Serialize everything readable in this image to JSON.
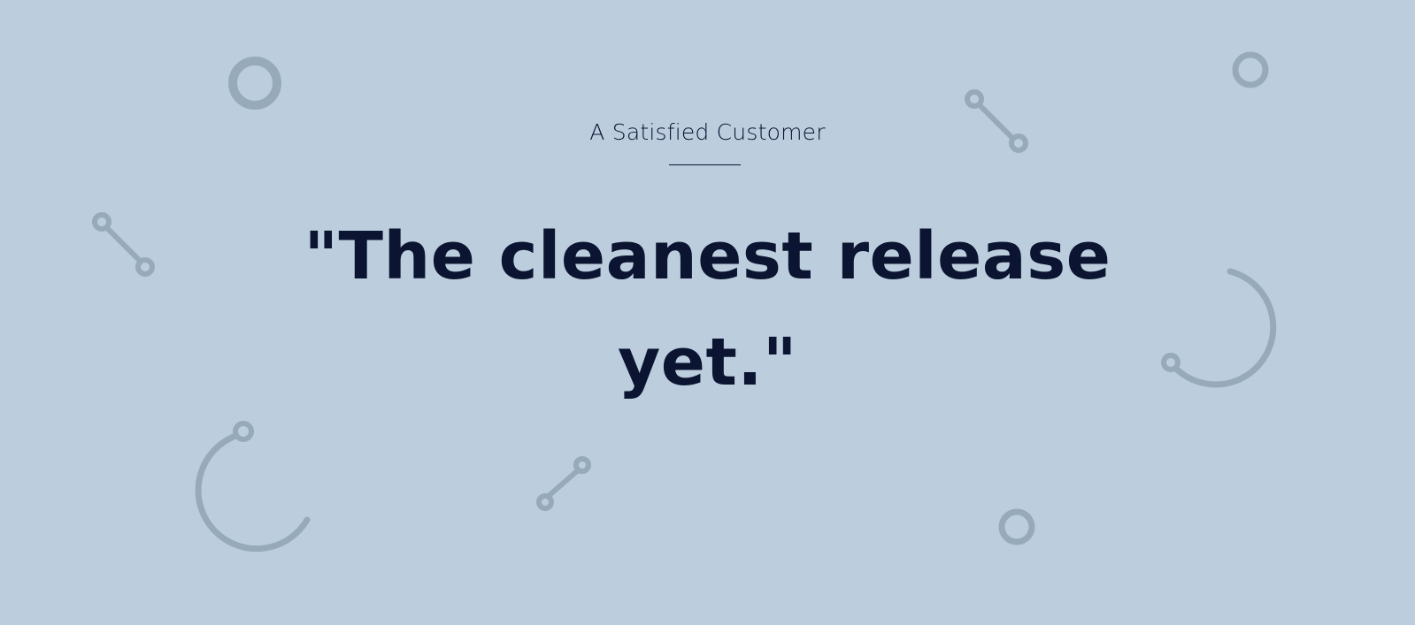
{
  "testimonial": {
    "eyebrow": "A Satisfied Customer",
    "quote": "\"The cleanest release yet.\""
  },
  "theme": {
    "background": "#bccede",
    "text": "#0b1430",
    "decoration": "#97aaba"
  },
  "decorations": [
    "ring-icon",
    "ring-icon",
    "ring-icon",
    "connector-icon",
    "connector-icon",
    "connector-icon",
    "arc-icon",
    "arc-icon"
  ]
}
